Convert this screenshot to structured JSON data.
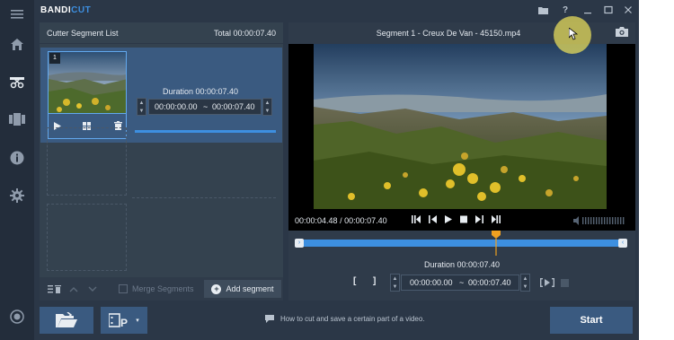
{
  "app": {
    "brand_main": "BANDI",
    "brand_accent": "CUT",
    "accent_color": "#3d8fe0",
    "window_buttons": [
      "folder-icon",
      "help-icon",
      "minimize-icon",
      "maximize-icon",
      "close-icon"
    ],
    "help_label": "?"
  },
  "rail": {
    "items": [
      "home-icon",
      "cut-icon",
      "merge-icon",
      "info-icon",
      "settings-icon"
    ],
    "active": "cut-icon",
    "bottom": "record-icon"
  },
  "segment_list": {
    "title": "Cutter Segment List",
    "total": "Total 00:00:07.40",
    "segments": [
      {
        "number": "1",
        "duration": "Duration 00:00:07.40",
        "start": "00:00:00.00",
        "separator": "~",
        "end": "00:00:07.40",
        "progress": 1.0
      }
    ],
    "footer": {
      "merge_label": "Merge Segments",
      "merge_checked": false,
      "add_label": "Add segment"
    }
  },
  "player": {
    "title": "Segment 1 - Creux De Van - 45150.mp4",
    "current_time": "00:00:04.48",
    "time_separator": "/",
    "total_time": "00:00:07.40",
    "playhead_fraction": 0.605,
    "duration": "Duration 00:00:07.40",
    "range_start": "00:00:00.00",
    "range_separator": "~",
    "range_end": "00:00:07.40",
    "bracket_open": "[",
    "bracket_close": "]"
  },
  "bottom": {
    "hint": "How to cut and save a certain part of a video.",
    "start_label": "Start"
  }
}
